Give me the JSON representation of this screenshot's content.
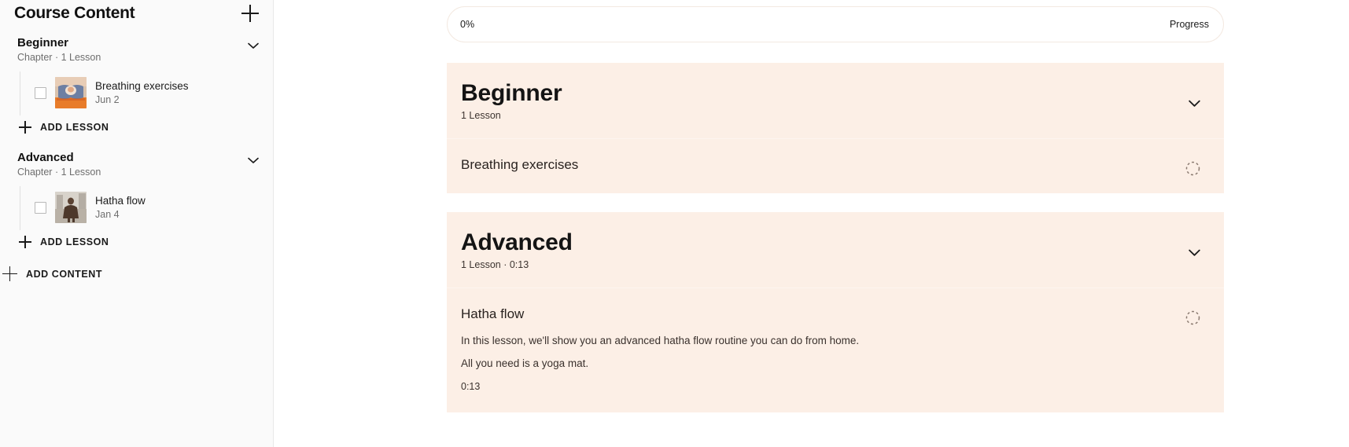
{
  "sidebar": {
    "title": "Course Content",
    "add_content_label": "Add Content",
    "add_icon": "plus-icon",
    "chapters": [
      {
        "name": "Beginner",
        "meta": "Chapter · 1 Lesson",
        "collapse_icon": "chevron-down-icon",
        "add_lesson_label": "Add Lesson",
        "lessons": [
          {
            "name": "Breathing exercises",
            "date": "Jun 2",
            "thumbnail": "person-seated-meditation-thumbnail",
            "checked": false
          }
        ]
      },
      {
        "name": "Advanced",
        "meta": "Chapter · 1 Lesson",
        "collapse_icon": "chevron-down-icon",
        "add_lesson_label": "Add Lesson",
        "lessons": [
          {
            "name": "Hatha flow",
            "date": "Jan 4",
            "thumbnail": "person-crouching-outdoors-thumbnail",
            "checked": false
          }
        ]
      }
    ]
  },
  "preview": {
    "progress": {
      "percent_label": "0%",
      "label": "Progress",
      "value": 0
    },
    "chapters": [
      {
        "title": "Beginner",
        "meta": "1 Lesson",
        "collapse_icon": "chevron-down-icon",
        "lessons": [
          {
            "title": "Breathing exercises",
            "description": "",
            "duration": "",
            "status_icon": "dashed-circle-incomplete-icon"
          }
        ]
      },
      {
        "title": "Advanced",
        "meta": "1 Lesson · 0:13",
        "collapse_icon": "chevron-down-icon",
        "lessons": [
          {
            "title": "Hatha flow",
            "description": "In this lesson, we'll show you an advanced hatha flow routine you can do from home. All you need is a yoga mat.",
            "duration": "0:13",
            "status_icon": "dashed-circle-incomplete-icon"
          }
        ]
      }
    ]
  },
  "colors": {
    "sidebar_bg": "#fafafa",
    "card_bg": "#fcefe6",
    "card_divider": "#fdf5ef",
    "progress_border": "#f3e9e1",
    "text_primary": "#111111",
    "text_muted": "#6e6e6e"
  }
}
